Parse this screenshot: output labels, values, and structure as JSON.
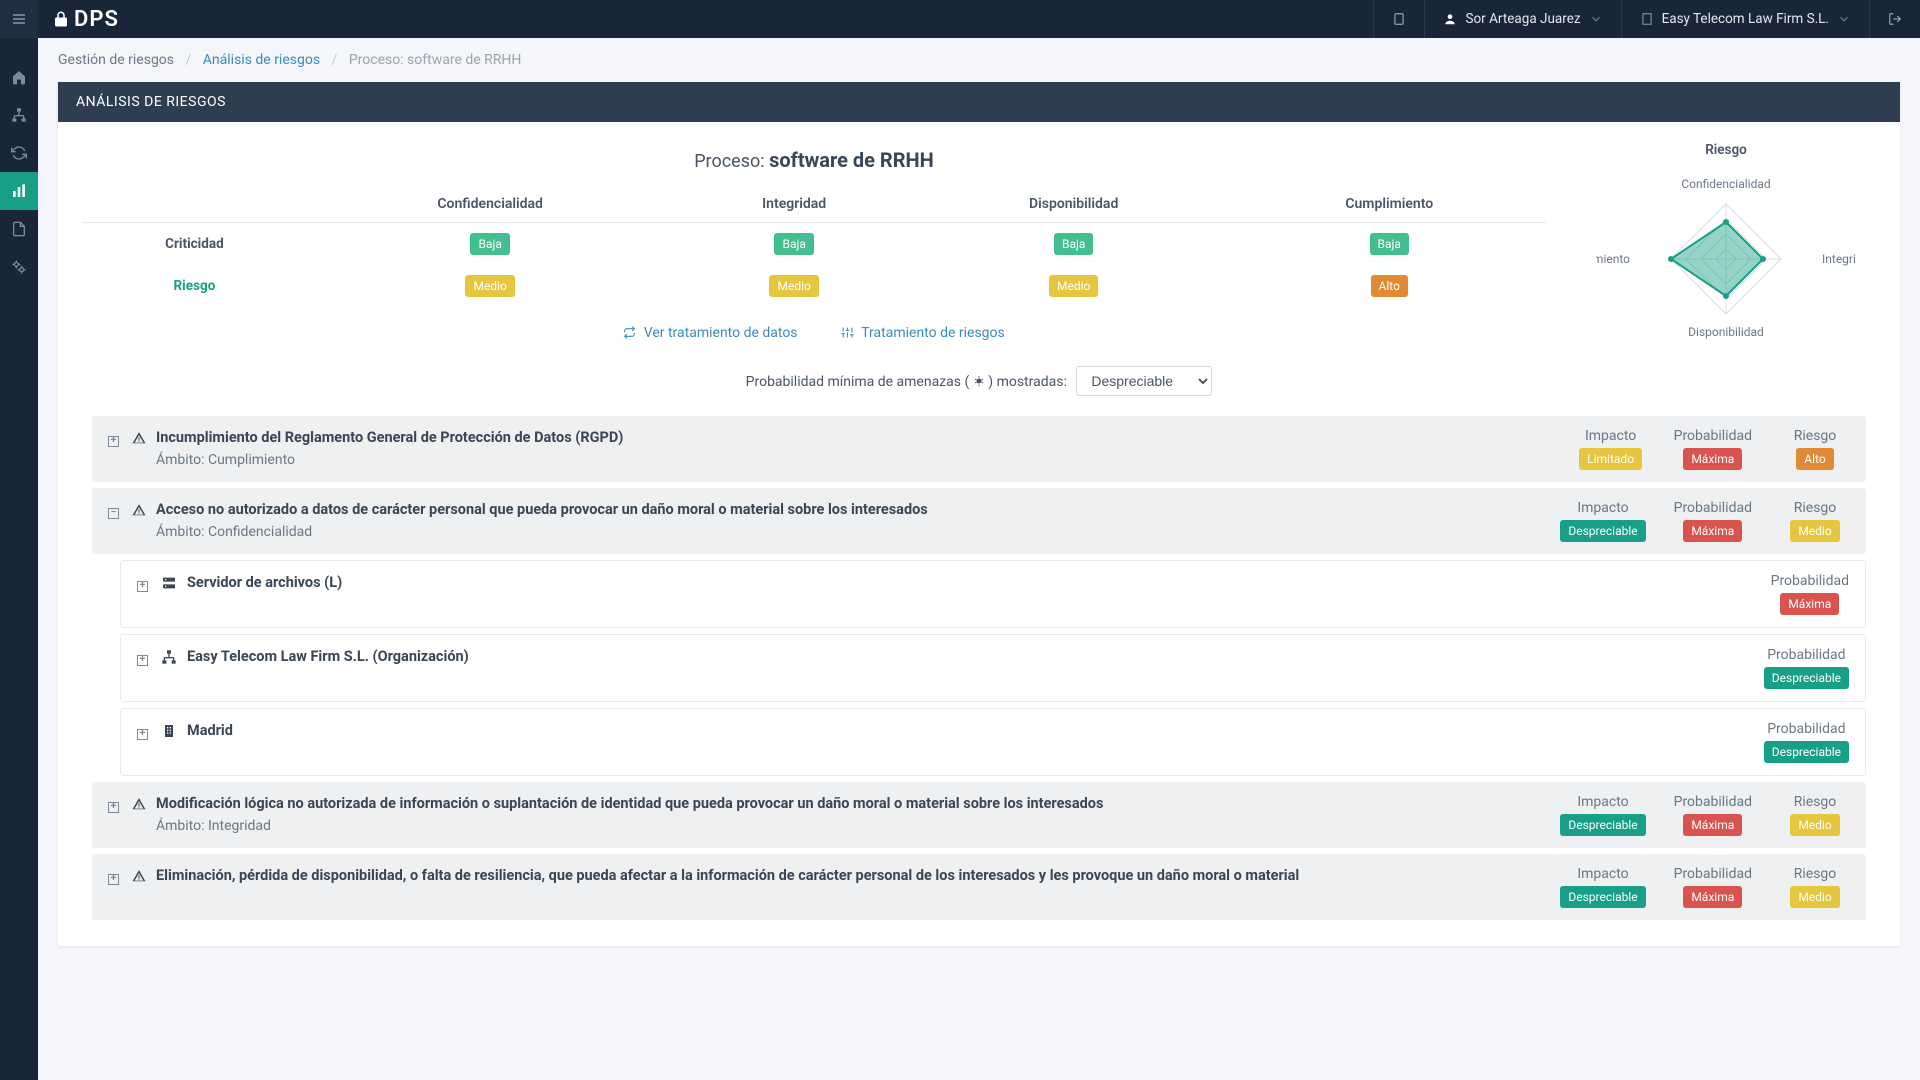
{
  "header": {
    "user_name": "Sor Arteaga Juarez",
    "org_name": "Easy Telecom Law Firm S.L."
  },
  "breadcrumb": {
    "root": "Gestión de riesgos",
    "mid": "Análisis de riesgos",
    "current": "Proceso: software de RRHH"
  },
  "panel_title": "ANÁLISIS DE RIESGOS",
  "process_label": "Proceso:",
  "process_name": "software de RRHH",
  "table": {
    "cols": [
      "Confidencialidad",
      "Integridad",
      "Disponibilidad",
      "Cumplimiento"
    ],
    "rows": {
      "criticidad": {
        "label": "Criticidad",
        "values": [
          "Baja",
          "Baja",
          "Baja",
          "Baja"
        ],
        "classes": [
          "b-baja",
          "b-baja",
          "b-baja",
          "b-baja"
        ]
      },
      "riesgo": {
        "label": "Riesgo",
        "values": [
          "Medio",
          "Medio",
          "Medio",
          "Alto"
        ],
        "classes": [
          "b-medio",
          "b-medio",
          "b-medio",
          "b-alto"
        ]
      }
    }
  },
  "links": {
    "treatment_data": "Ver tratamiento de datos",
    "treatment_risk": "Tratamiento de riesgos"
  },
  "prob_filter": {
    "label_pre": "Probabilidad mínima de amenazas (",
    "label_post": ") mostradas:",
    "selected": "Despreciable"
  },
  "radar": {
    "title": "Riesgo",
    "axes": [
      "Confidencialidad",
      "Integridad",
      "Disponibilidad",
      "Cumplimiento"
    ]
  },
  "chart_data": {
    "type": "radar",
    "title": "Riesgo",
    "axes": [
      "Confidencialidad",
      "Integridad",
      "Disponibilidad",
      "Cumplimiento"
    ],
    "scale": {
      "min": 0,
      "max": 3,
      "levels": [
        "Despreciable",
        "Bajo",
        "Medio",
        "Alto"
      ]
    },
    "series": [
      {
        "name": "Riesgo",
        "values": [
          2,
          2,
          2,
          3
        ],
        "color": "#17a087"
      }
    ]
  },
  "threats": [
    {
      "expand": "plus",
      "title": "Incumplimiento del Reglamento General de Protección de Datos (RGPD)",
      "scope_label": "Ámbito:",
      "scope": "Cumplimiento",
      "metrics": {
        "impacto": {
          "label": "Impacto",
          "value": "Limitado",
          "class": "b-limitado"
        },
        "probabilidad": {
          "label": "Probabilidad",
          "value": "Máxima",
          "class": "b-maxima"
        },
        "riesgo": {
          "label": "Riesgo",
          "value": "Alto",
          "class": "b-alto"
        }
      }
    },
    {
      "expand": "minus",
      "title": "Acceso no autorizado a datos de carácter personal que pueda provocar un daño moral o material sobre los interesados",
      "scope_label": "Ámbito:",
      "scope": "Confidencialidad",
      "metrics": {
        "impacto": {
          "label": "Impacto",
          "value": "Despreciable",
          "class": "b-despreciable"
        },
        "probabilidad": {
          "label": "Probabilidad",
          "value": "Máxima",
          "class": "b-maxima"
        },
        "riesgo": {
          "label": "Riesgo",
          "value": "Medio",
          "class": "b-medio"
        }
      },
      "children": [
        {
          "icon": "server",
          "title": "Servidor de archivos (L)",
          "prob_label": "Probabilidad",
          "prob_value": "Máxima",
          "prob_class": "b-maxima"
        },
        {
          "icon": "org",
          "title": "Easy Telecom Law Firm S.L. (Organización)",
          "prob_label": "Probabilidad",
          "prob_value": "Despreciable",
          "prob_class": "b-despreciable"
        },
        {
          "icon": "building",
          "title": "Madrid",
          "prob_label": "Probabilidad",
          "prob_value": "Despreciable",
          "prob_class": "b-despreciable"
        }
      ]
    },
    {
      "expand": "plus",
      "title": "Modificación lógica no autorizada de información o suplantación de identidad que pueda provocar un daño moral o material sobre los interesados",
      "scope_label": "Ámbito:",
      "scope": "Integridad",
      "metrics": {
        "impacto": {
          "label": "Impacto",
          "value": "Despreciable",
          "class": "b-despreciable"
        },
        "probabilidad": {
          "label": "Probabilidad",
          "value": "Máxima",
          "class": "b-maxima"
        },
        "riesgo": {
          "label": "Riesgo",
          "value": "Medio",
          "class": "b-medio"
        }
      }
    },
    {
      "expand": "plus",
      "title": "Eliminación, pérdida de disponibilidad, o falta de resiliencia, que pueda afectar a la información de carácter personal de los interesados y les provoque un daño moral o material",
      "scope_label": "Ámbito:",
      "scope": "",
      "metrics": {
        "impacto": {
          "label": "Impacto",
          "value": "Despreciable",
          "class": "b-despreciable"
        },
        "probabilidad": {
          "label": "Probabilidad",
          "value": "Máxima",
          "class": "b-maxima"
        },
        "riesgo": {
          "label": "Riesgo",
          "value": "Medio",
          "class": "b-medio"
        }
      }
    }
  ]
}
